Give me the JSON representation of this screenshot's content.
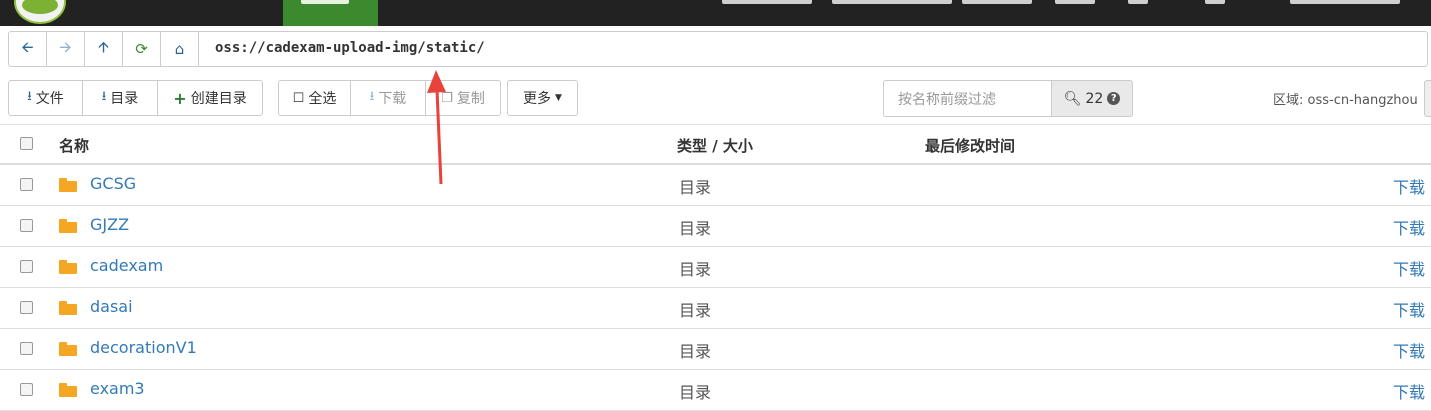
{
  "address": {
    "path": "oss://cadexam-upload-img/static/"
  },
  "nav": {
    "back_icon": "arrow-left-icon",
    "forward_icon": "arrow-right-icon",
    "up_icon": "arrow-up-icon",
    "refresh_icon": "refresh-icon",
    "home_icon": "home-icon"
  },
  "toolbar": {
    "upload_file": "文件",
    "upload_dir": "目录",
    "create_dir": "创建目录",
    "select_all": "全选",
    "download": "下载",
    "copy": "复制",
    "more": "更多",
    "filter_placeholder": "按名称前缀过滤",
    "search_count": "22",
    "region_label": "区域: oss-cn-hangzhou"
  },
  "table": {
    "headers": {
      "name": "名称",
      "type_size": "类型 / 大小",
      "modified": "最后修改时间"
    },
    "rows": [
      {
        "name": "GCSG",
        "type": "目录",
        "action": "下载"
      },
      {
        "name": "GJZZ",
        "type": "目录",
        "action": "下载"
      },
      {
        "name": "cadexam",
        "type": "目录",
        "action": "下载"
      },
      {
        "name": "dasai",
        "type": "目录",
        "action": "下载"
      },
      {
        "name": "decorationV1",
        "type": "目录",
        "action": "下载"
      },
      {
        "name": "exam3",
        "type": "目录",
        "action": "下载"
      }
    ]
  },
  "colors": {
    "link": "#337ab7",
    "arrow": "#e8433a",
    "topbar": "#222222",
    "accent_green": "#3b8a2e"
  }
}
